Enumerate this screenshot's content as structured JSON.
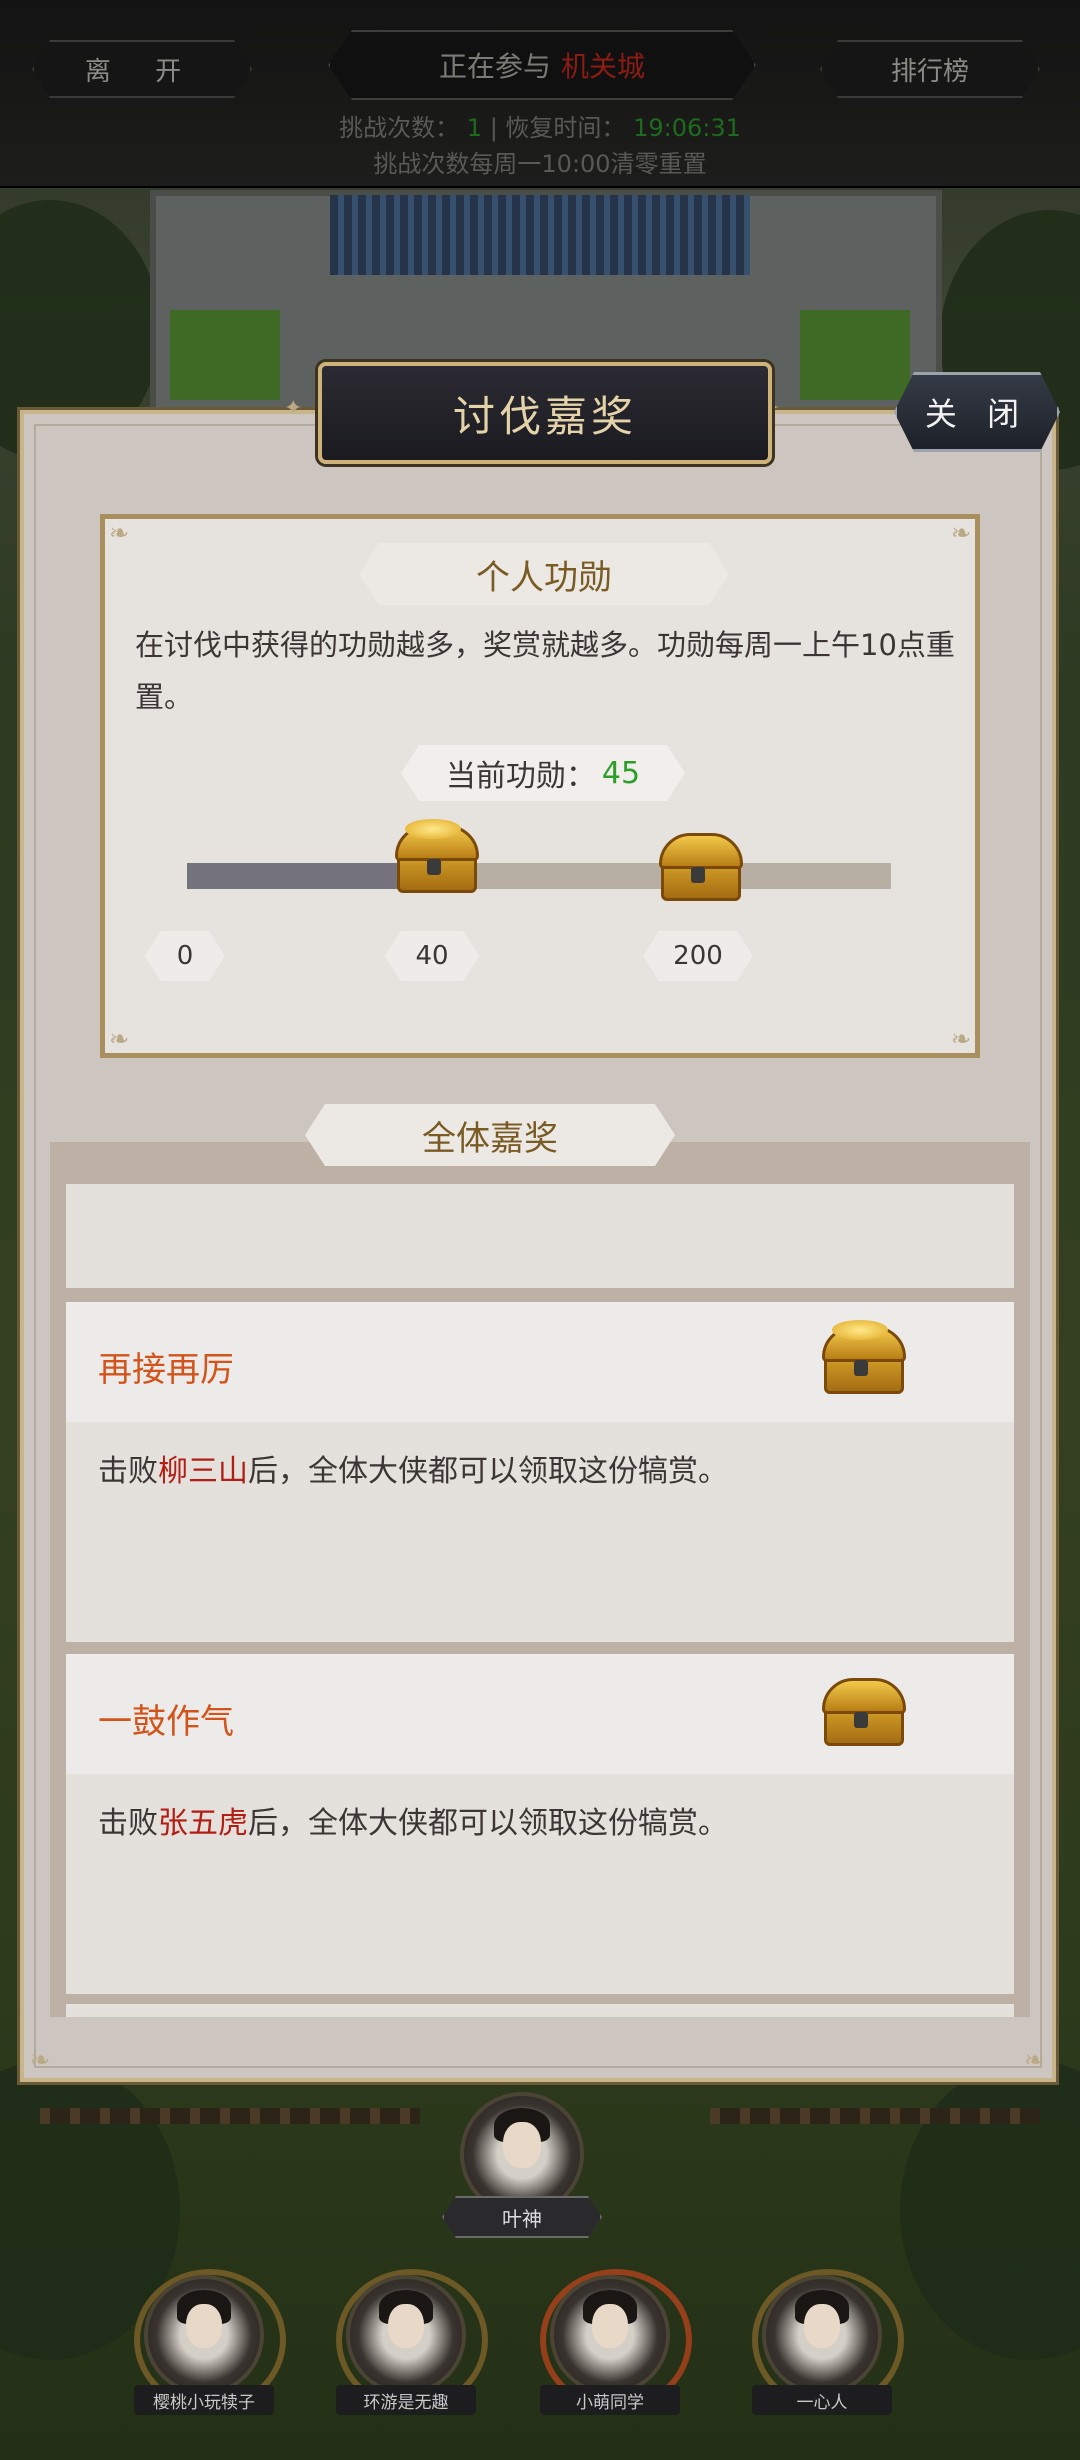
{
  "topbar": {
    "leave_label": "离 开",
    "title_prefix": "正在参与",
    "title_city": "机关城",
    "rank_label": "排行榜",
    "challenge_label": "挑战次数：",
    "challenge_count": "1",
    "recover_label": "恢复时间：",
    "recover_time": "19:06:31",
    "reset_note": "挑战次数每周一10:00清零重置"
  },
  "panel": {
    "title": "讨伐嘉奖",
    "close_label": "关 闭",
    "personal": {
      "tag": "个人功勋",
      "description": "在讨伐中获得的功勋越多，奖赏就越多。功勋每周一上午10点重置。",
      "current_label": "当前功勋：",
      "current_value": "45",
      "progress_max": 200,
      "milestones": [
        "0",
        "40",
        "200"
      ]
    },
    "group": {
      "tag": "全体嘉奖",
      "cards": [
        {
          "title": "再接再厉",
          "desc_prefix": "击败",
          "boss": "柳三山",
          "desc_suffix": "后，全体大侠都可以领取这份犒赏。"
        },
        {
          "title": "一鼓作气",
          "desc_prefix": "击败",
          "boss": "张五虎",
          "desc_suffix": "后，全体大侠都可以领取这份犒赏。"
        }
      ]
    }
  },
  "party": {
    "leader": "叶神",
    "members": [
      "樱桃小玩犊子",
      "环游是无趣",
      "小萌同学",
      "一心人"
    ]
  },
  "colors": {
    "accent_orange": "#d2541b",
    "boss_red": "#b21d14",
    "merit_green": "#2aa02a",
    "gold_border": "#cdb37a"
  }
}
